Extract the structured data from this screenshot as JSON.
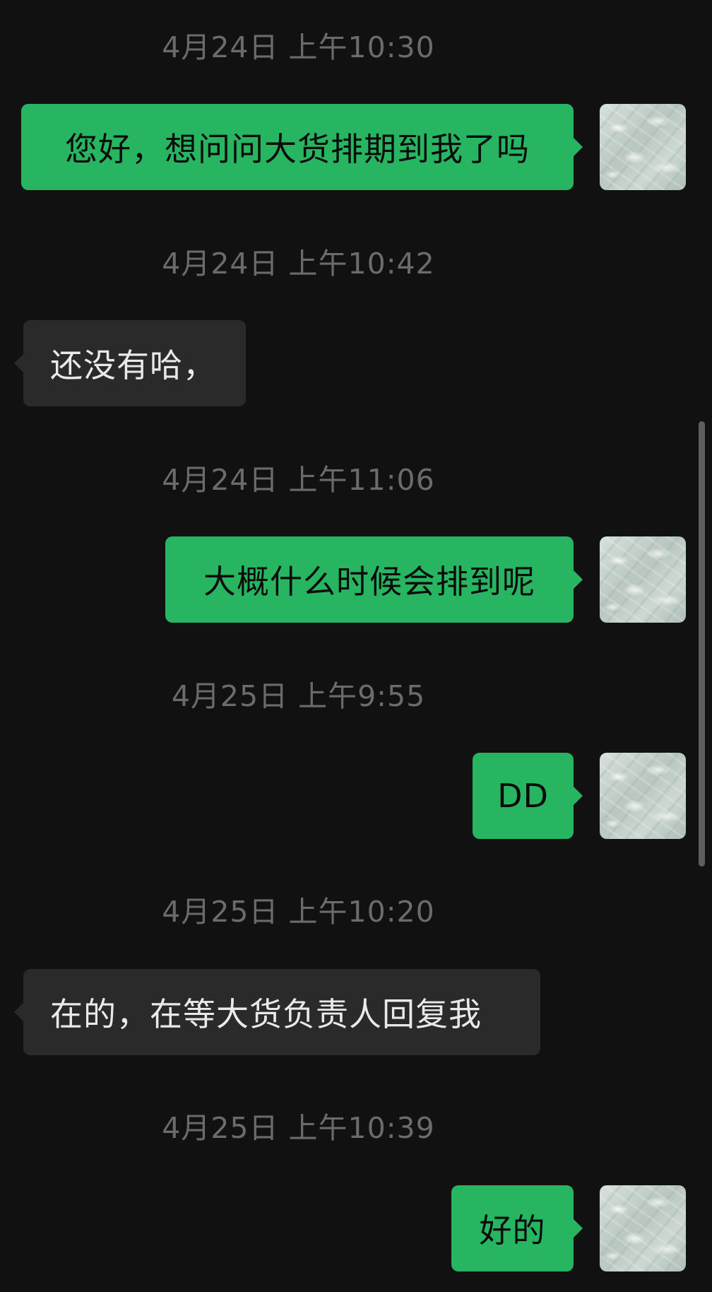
{
  "conversation": {
    "timestamps": [
      "4月24日 上午10:30",
      "4月24日 上午10:42",
      "4月24日 上午11:06",
      "4月25日 上午9:55",
      "4月25日 上午10:20",
      "4月25日 上午10:39"
    ],
    "messages": [
      {
        "sender": "me",
        "text": "您好，想问问大货排期到我了吗"
      },
      {
        "sender": "other",
        "text": "还没有哈，"
      },
      {
        "sender": "me",
        "text": "大概什么时候会排到呢"
      },
      {
        "sender": "me",
        "text": "DD"
      },
      {
        "sender": "other",
        "text": "在的，在等大货负责人回复我"
      },
      {
        "sender": "me",
        "text": "好的"
      }
    ]
  },
  "colors": {
    "background": "#111111",
    "outgoing_bubble": "#27b561",
    "incoming_bubble": "#2a2a2a",
    "timestamp_text": "#6b6b6b"
  },
  "icons": {
    "avatar": "water-texture-avatar"
  }
}
